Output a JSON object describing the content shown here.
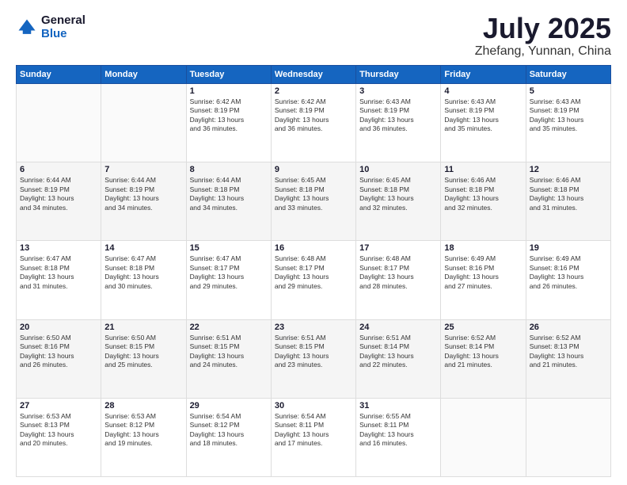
{
  "logo": {
    "general": "General",
    "blue": "Blue"
  },
  "title": {
    "month": "July 2025",
    "location": "Zhefang, Yunnan, China"
  },
  "weekdays": [
    "Sunday",
    "Monday",
    "Tuesday",
    "Wednesday",
    "Thursday",
    "Friday",
    "Saturday"
  ],
  "weeks": [
    [
      {
        "day": "",
        "info": ""
      },
      {
        "day": "",
        "info": ""
      },
      {
        "day": "1",
        "info": "Sunrise: 6:42 AM\nSunset: 8:19 PM\nDaylight: 13 hours\nand 36 minutes."
      },
      {
        "day": "2",
        "info": "Sunrise: 6:42 AM\nSunset: 8:19 PM\nDaylight: 13 hours\nand 36 minutes."
      },
      {
        "day": "3",
        "info": "Sunrise: 6:43 AM\nSunset: 8:19 PM\nDaylight: 13 hours\nand 36 minutes."
      },
      {
        "day": "4",
        "info": "Sunrise: 6:43 AM\nSunset: 8:19 PM\nDaylight: 13 hours\nand 35 minutes."
      },
      {
        "day": "5",
        "info": "Sunrise: 6:43 AM\nSunset: 8:19 PM\nDaylight: 13 hours\nand 35 minutes."
      }
    ],
    [
      {
        "day": "6",
        "info": "Sunrise: 6:44 AM\nSunset: 8:19 PM\nDaylight: 13 hours\nand 34 minutes."
      },
      {
        "day": "7",
        "info": "Sunrise: 6:44 AM\nSunset: 8:19 PM\nDaylight: 13 hours\nand 34 minutes."
      },
      {
        "day": "8",
        "info": "Sunrise: 6:44 AM\nSunset: 8:18 PM\nDaylight: 13 hours\nand 34 minutes."
      },
      {
        "day": "9",
        "info": "Sunrise: 6:45 AM\nSunset: 8:18 PM\nDaylight: 13 hours\nand 33 minutes."
      },
      {
        "day": "10",
        "info": "Sunrise: 6:45 AM\nSunset: 8:18 PM\nDaylight: 13 hours\nand 32 minutes."
      },
      {
        "day": "11",
        "info": "Sunrise: 6:46 AM\nSunset: 8:18 PM\nDaylight: 13 hours\nand 32 minutes."
      },
      {
        "day": "12",
        "info": "Sunrise: 6:46 AM\nSunset: 8:18 PM\nDaylight: 13 hours\nand 31 minutes."
      }
    ],
    [
      {
        "day": "13",
        "info": "Sunrise: 6:47 AM\nSunset: 8:18 PM\nDaylight: 13 hours\nand 31 minutes."
      },
      {
        "day": "14",
        "info": "Sunrise: 6:47 AM\nSunset: 8:18 PM\nDaylight: 13 hours\nand 30 minutes."
      },
      {
        "day": "15",
        "info": "Sunrise: 6:47 AM\nSunset: 8:17 PM\nDaylight: 13 hours\nand 29 minutes."
      },
      {
        "day": "16",
        "info": "Sunrise: 6:48 AM\nSunset: 8:17 PM\nDaylight: 13 hours\nand 29 minutes."
      },
      {
        "day": "17",
        "info": "Sunrise: 6:48 AM\nSunset: 8:17 PM\nDaylight: 13 hours\nand 28 minutes."
      },
      {
        "day": "18",
        "info": "Sunrise: 6:49 AM\nSunset: 8:16 PM\nDaylight: 13 hours\nand 27 minutes."
      },
      {
        "day": "19",
        "info": "Sunrise: 6:49 AM\nSunset: 8:16 PM\nDaylight: 13 hours\nand 26 minutes."
      }
    ],
    [
      {
        "day": "20",
        "info": "Sunrise: 6:50 AM\nSunset: 8:16 PM\nDaylight: 13 hours\nand 26 minutes."
      },
      {
        "day": "21",
        "info": "Sunrise: 6:50 AM\nSunset: 8:15 PM\nDaylight: 13 hours\nand 25 minutes."
      },
      {
        "day": "22",
        "info": "Sunrise: 6:51 AM\nSunset: 8:15 PM\nDaylight: 13 hours\nand 24 minutes."
      },
      {
        "day": "23",
        "info": "Sunrise: 6:51 AM\nSunset: 8:15 PM\nDaylight: 13 hours\nand 23 minutes."
      },
      {
        "day": "24",
        "info": "Sunrise: 6:51 AM\nSunset: 8:14 PM\nDaylight: 13 hours\nand 22 minutes."
      },
      {
        "day": "25",
        "info": "Sunrise: 6:52 AM\nSunset: 8:14 PM\nDaylight: 13 hours\nand 21 minutes."
      },
      {
        "day": "26",
        "info": "Sunrise: 6:52 AM\nSunset: 8:13 PM\nDaylight: 13 hours\nand 21 minutes."
      }
    ],
    [
      {
        "day": "27",
        "info": "Sunrise: 6:53 AM\nSunset: 8:13 PM\nDaylight: 13 hours\nand 20 minutes."
      },
      {
        "day": "28",
        "info": "Sunrise: 6:53 AM\nSunset: 8:12 PM\nDaylight: 13 hours\nand 19 minutes."
      },
      {
        "day": "29",
        "info": "Sunrise: 6:54 AM\nSunset: 8:12 PM\nDaylight: 13 hours\nand 18 minutes."
      },
      {
        "day": "30",
        "info": "Sunrise: 6:54 AM\nSunset: 8:11 PM\nDaylight: 13 hours\nand 17 minutes."
      },
      {
        "day": "31",
        "info": "Sunrise: 6:55 AM\nSunset: 8:11 PM\nDaylight: 13 hours\nand 16 minutes."
      },
      {
        "day": "",
        "info": ""
      },
      {
        "day": "",
        "info": ""
      }
    ]
  ]
}
